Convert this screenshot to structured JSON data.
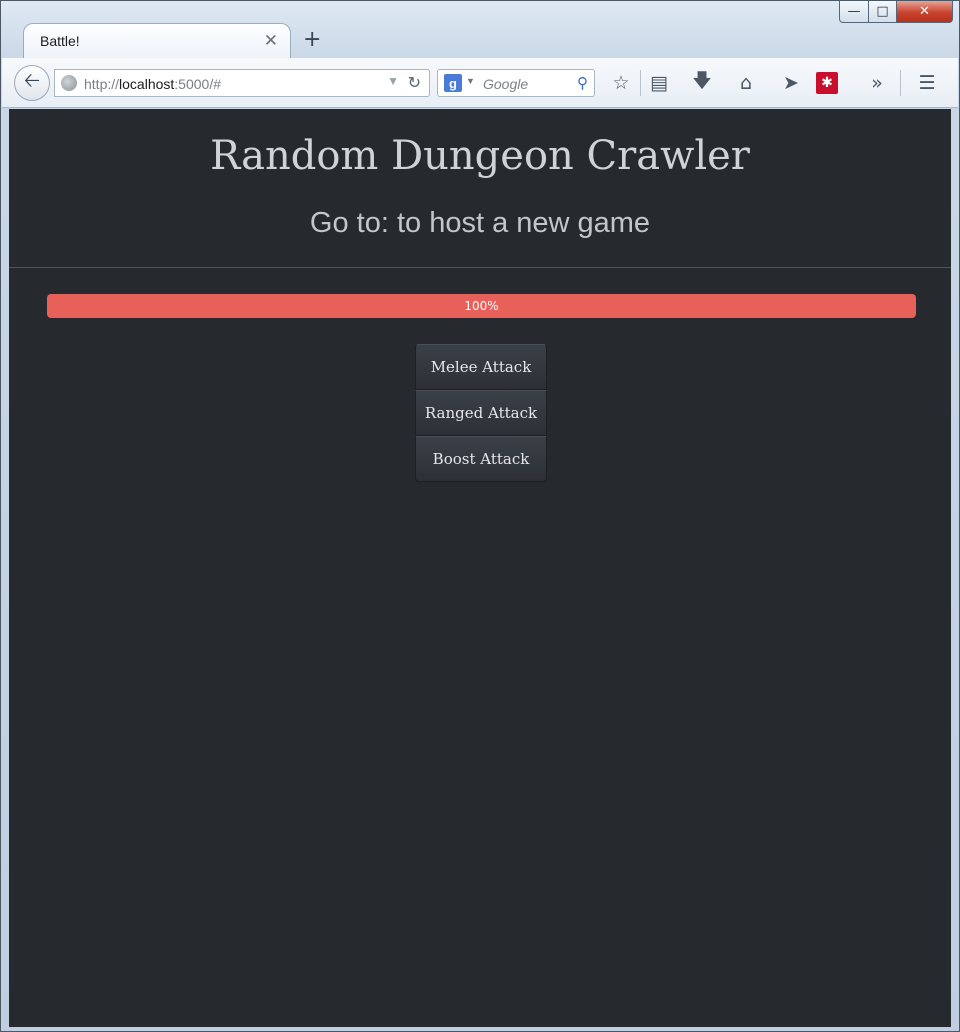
{
  "browser": {
    "tab_title": "Battle!",
    "new_tab_symbol": "+",
    "url_protocol": "http://",
    "url_host": "localhost",
    "url_rest": ":5000/#",
    "search_placeholder": "Google"
  },
  "page": {
    "title": "Random Dungeon Crawler",
    "subtitle": "Go to: to host a new game",
    "progress": {
      "label": "100%",
      "fraction": 1.0,
      "color": "#e8605a"
    },
    "actions": [
      {
        "label": "Melee Attack"
      },
      {
        "label": "Ranged Attack"
      },
      {
        "label": "Boost Attack"
      }
    ]
  },
  "colors": {
    "page_background": "#26292e",
    "progress_fill": "#e8605a"
  }
}
